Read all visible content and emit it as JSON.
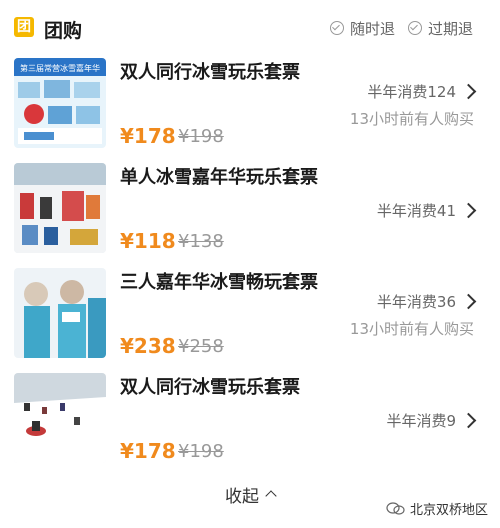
{
  "header": {
    "badge": "团",
    "title": "团购",
    "policies": [
      "随时退",
      "过期退"
    ]
  },
  "deals": [
    {
      "title": "双人同行冰雪玩乐套票",
      "sales": "半年消费124",
      "recent": "13小时前有人购买",
      "price": "¥178",
      "original_price": "¥198",
      "thumb_caption": "第三届常营冰雪嘉年华"
    },
    {
      "title": "单人冰雪嘉年华玩乐套票",
      "sales": "半年消费41",
      "recent": "",
      "price": "¥118",
      "original_price": "¥138",
      "thumb_caption": ""
    },
    {
      "title": "三人嘉年华冰雪畅玩套票",
      "sales": "半年消费36",
      "recent": "13小时前有人购买",
      "price": "¥238",
      "original_price": "¥258",
      "thumb_caption": ""
    },
    {
      "title": "双人同行冰雪玩乐套票",
      "sales": "半年消费9",
      "recent": "",
      "price": "¥178",
      "original_price": "¥198",
      "thumb_caption": ""
    }
  ],
  "footer": {
    "collapse_label": "收起",
    "watermark": "北京双桥地区"
  },
  "colors": {
    "price": "#f08a1d",
    "badge": "#f5b800"
  }
}
